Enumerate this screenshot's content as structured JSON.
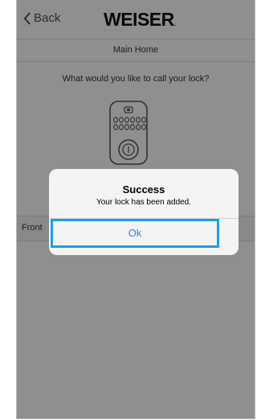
{
  "navbar": {
    "back_label": "Back",
    "brand": "WEISER",
    "brand_mark": "."
  },
  "subheader": {
    "home_name": "Main Home"
  },
  "content": {
    "question": "What would you like to call your lock?",
    "name_value": "Front"
  },
  "alert": {
    "title": "Success",
    "message": "Your lock has been added.",
    "ok_label": "Ok"
  },
  "colors": {
    "accent_highlight": "#1aa0e6",
    "ios_blue": "#2a7fe6",
    "overlay": "rgba(0,0,0,0.42)"
  }
}
